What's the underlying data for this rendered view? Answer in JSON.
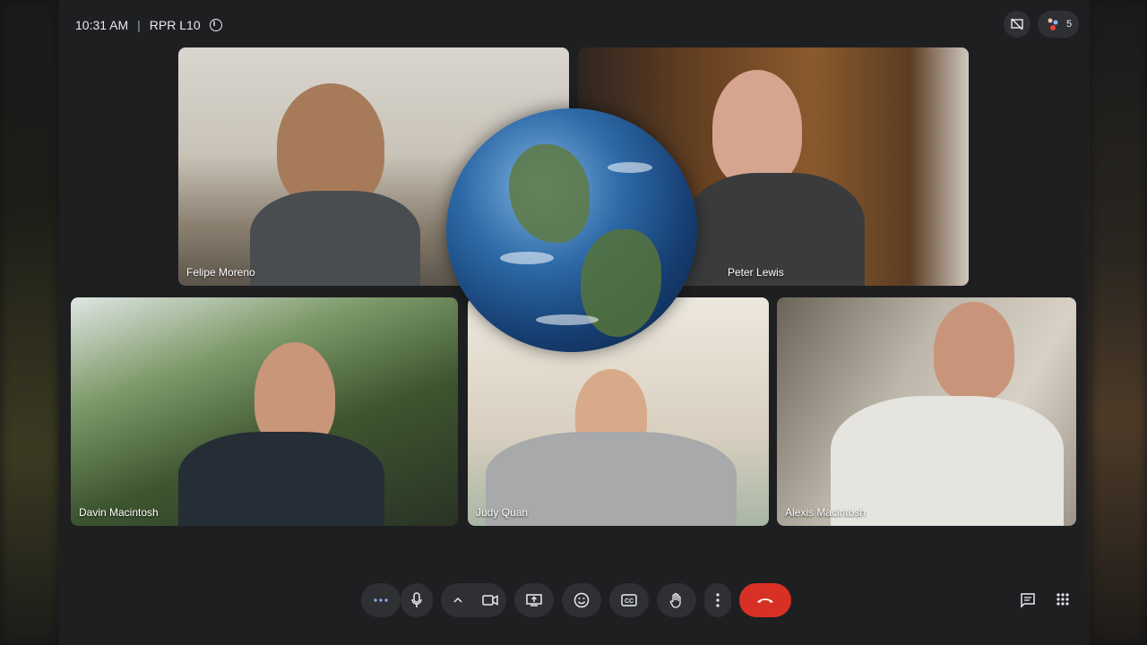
{
  "meeting": {
    "time": "10:31 AM",
    "separator": "|",
    "code": "RPR L10"
  },
  "people": {
    "count": "5"
  },
  "participants": [
    {
      "name": "Felipe Moreno"
    },
    {
      "name": "Peter Lewis"
    },
    {
      "name": "Davin Macintosh"
    },
    {
      "name": "Judy Quan"
    },
    {
      "name": "Alexis Macintosh"
    }
  ],
  "icons": {
    "info": "info-icon",
    "presenting_off": "presentation-off-icon",
    "people": "people-icon",
    "more_options": "more-horizontal-icon",
    "mic": "microphone-icon",
    "camera_options": "chevron-up-icon",
    "camera": "camera-icon",
    "present": "present-screen-icon",
    "reactions": "emoji-icon",
    "captions": "closed-captions-icon",
    "raise_hand": "hand-icon",
    "more_vert": "more-vertical-icon",
    "end_call": "end-call-icon",
    "chat": "chat-icon",
    "activities": "apps-grid-icon"
  },
  "colors": {
    "end_call": "#d93025",
    "control_bg": "#2f3033",
    "background": "#1e1f21"
  }
}
